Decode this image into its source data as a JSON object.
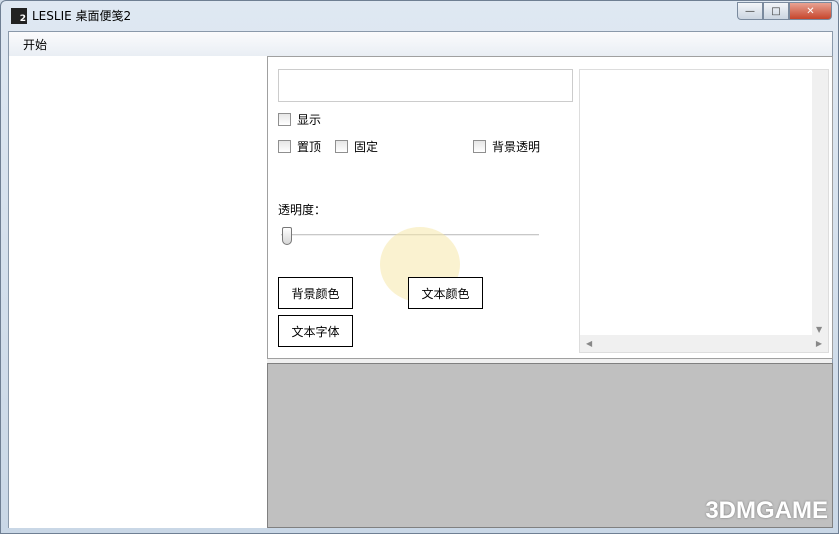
{
  "window": {
    "title": "LESLIE 桌面便笺2",
    "logo_text": "2",
    "minimize": "—",
    "maximize": "□",
    "close": "✕"
  },
  "menu": {
    "items": [
      {
        "label": "开始"
      }
    ]
  },
  "settings": {
    "text_value": "",
    "show_label": "显示",
    "topmost_label": "置顶",
    "fixed_label": "固定",
    "bg_transparent_label": "背景透明",
    "opacity_label": "透明度：",
    "opacity_value": 0,
    "bg_color_button": "背景颜色",
    "text_color_button": "文本颜色",
    "text_font_button": "文本字体"
  },
  "watermark": "3DMGAME"
}
